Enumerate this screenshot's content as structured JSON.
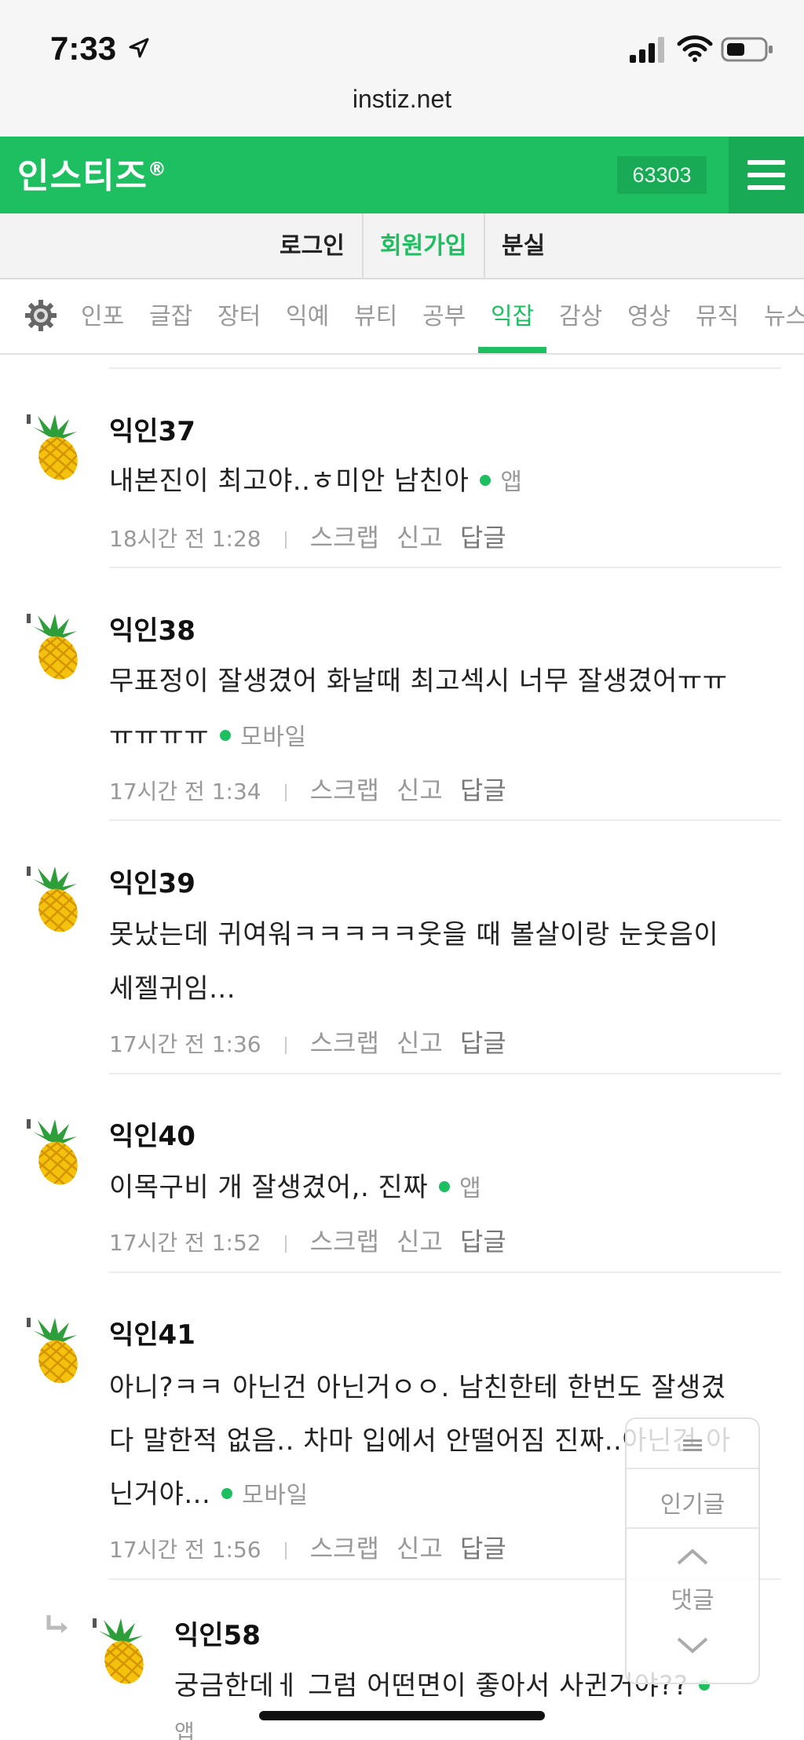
{
  "status": {
    "time": "7:33",
    "url": "instiz.net"
  },
  "header": {
    "logo": "인스티즈",
    "logo_mark": "®",
    "visit_count": "63303"
  },
  "auth": {
    "login": "로그인",
    "signup": "회원가입",
    "lost": "분실"
  },
  "tabs": [
    "인포",
    "글잡",
    "장터",
    "익예",
    "뷰티",
    "공부",
    "익잡",
    "감상",
    "영상",
    "뮤직",
    "뉴스"
  ],
  "active_tab": "익잡",
  "actions": {
    "scrap": "스크랩",
    "report": "신고",
    "reply": "답글"
  },
  "comments": [
    {
      "nick": "익인37",
      "lines": [
        "내본진이 최고야..ㅎ미안 남친아"
      ],
      "source": "앱",
      "time": "18시간 전",
      "clock": "1:28"
    },
    {
      "nick": "익인38",
      "lines": [
        "무표정이 잘생겼어 화날때 최고섹시 너무 잘생겼어ㅠㅠ",
        "ㅠㅠㅠㅠ"
      ],
      "source": "모바일",
      "time": "17시간 전",
      "clock": "1:34"
    },
    {
      "nick": "익인39",
      "lines": [
        "못났는데 귀여워ㅋㅋㅋㅋㅋ웃을 때 볼살이랑 눈웃음이",
        "세젤귀임..."
      ],
      "source": "",
      "time": "17시간 전",
      "clock": "1:36"
    },
    {
      "nick": "익인40",
      "lines": [
        "이목구비 개 잘생겼어,. 진짜"
      ],
      "source": "앱",
      "time": "17시간 전",
      "clock": "1:52"
    },
    {
      "nick": "익인41",
      "lines": [
        "아니?ㅋㅋ 아닌건 아닌거ㅇㅇ. 남친한테 한번도 잘생겼",
        "다 말한적 없음.. 차마 입에서 안떨어짐 진짜..아닌건 아",
        "닌거야..."
      ],
      "source": "모바일",
      "time": "17시간 전",
      "clock": "1:56"
    }
  ],
  "reply_comment": {
    "nick": "익인58",
    "lines": [
      "궁금한데ㅔ 그럼 어떤면이 좋아서 사귄거야??"
    ],
    "source": "앱"
  },
  "floatnav": {
    "popular": "인기글",
    "comments": "댓글"
  },
  "colors": {
    "brand": "#1dbf60",
    "brand_dark": "#19aa55"
  }
}
